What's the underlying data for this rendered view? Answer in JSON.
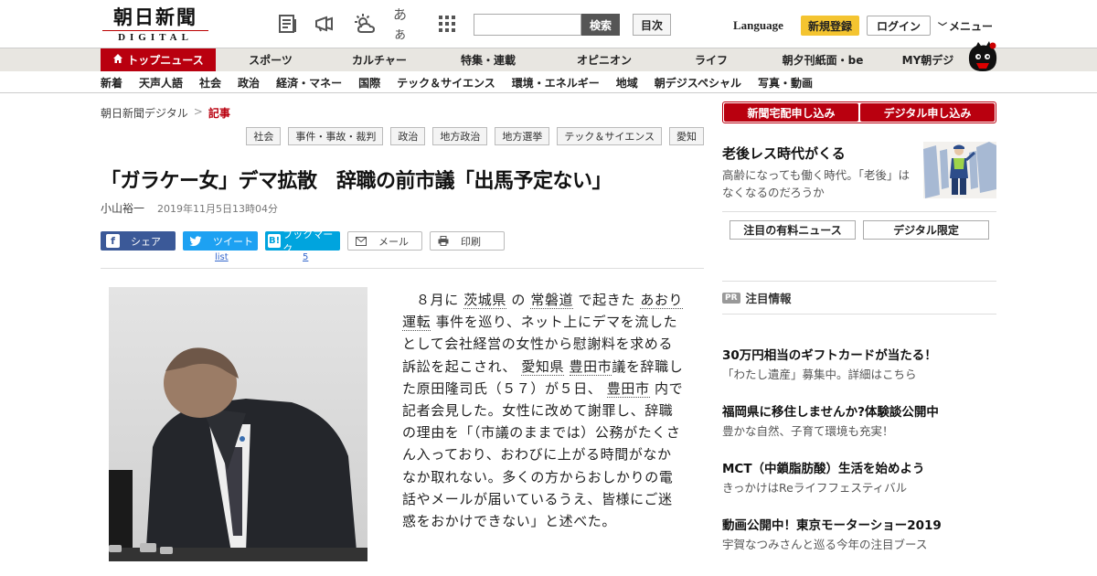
{
  "header": {
    "logo_main": "朝日新聞",
    "logo_sub": "DIGITAL",
    "icons": [
      "newspaper-icon",
      "megaphone-icon",
      "weather-icon",
      "font-size-icon",
      "grid-menu-icon"
    ],
    "font_size_glyph": "あぁ",
    "search_placeholder": "",
    "search_button": "検索",
    "toc_button": "目次",
    "language": "Language",
    "register": "新規登録",
    "login": "ログイン",
    "menu": "メニュー"
  },
  "main_nav": [
    {
      "label": "トップニュース",
      "active": true
    },
    {
      "label": "スポーツ"
    },
    {
      "label": "カルチャー"
    },
    {
      "label": "特集・連載"
    },
    {
      "label": "オピニオン"
    },
    {
      "label": "ライフ"
    },
    {
      "label": "朝夕刊紙面・be"
    },
    {
      "label": "MY朝デジ"
    }
  ],
  "sub_nav": [
    "新着",
    "天声人語",
    "社会",
    "政治",
    "経済・マネー",
    "国際",
    "テック＆サイエンス",
    "環境・エネルギー",
    "地域",
    "朝デジスペシャル",
    "写真・動画"
  ],
  "breadcrumb": {
    "root": "朝日新聞デジタル",
    "sep": ">",
    "current": "記事"
  },
  "tags": [
    "社会",
    "事件・事故・裁判",
    "政治",
    "地方政治",
    "地方選挙",
    "テック＆サイエンス",
    "愛知"
  ],
  "article": {
    "title": "「ガラケー女」デマ拡散　辞職の前市議「出馬予定ない」",
    "author": "小山裕一",
    "date": "2019年11月5日13時04分",
    "share": {
      "facebook": "シェア",
      "twitter": "ツイート",
      "hatena": "ブックマーク",
      "hatena_icon": "B!",
      "mail": "メール",
      "print": "印刷",
      "twitter_count": "list",
      "hatena_count": "5"
    },
    "body": {
      "p1": "８月に",
      "k1": "茨城県",
      "p2": "の",
      "k2": "常磐道",
      "p3": "で起きた",
      "k3": "あおり運転",
      "p4": "事件を巡り、ネット上にデマを流したとして会社経営の女性から慰謝料を求める訴訟を起こされ、",
      "k4": "愛知県",
      "k5": "豊田市",
      "p5": "議を辞職した原田隆司氏（５７）が５日、",
      "k6": "豊田市",
      "p6": "内で記者会見した。女性に改めて謝罪し、辞職の理由を「（市議のままでは）公務がたくさん入っており、おわびに上がる時間がなかなか取れない。多くの方からおしかりの電話やメールが届いているうえ、皆様にご迷惑をおかけできない」と述べた。"
    }
  },
  "sidebar": {
    "subscribe": [
      "新聞宅配申し込み",
      "デジタル申し込み"
    ],
    "promo": {
      "title": "老後レス時代がくる",
      "desc": "高齢になっても働く時代。「老後」はなくなるのだろうか"
    },
    "buttons": [
      "注目の有料ニュース",
      "デジタル限定"
    ],
    "pr": {
      "badge": "PR",
      "label": "注目情報"
    },
    "ads": [
      {
        "title": "30万円相当のギフトカードが当たる！",
        "sub": "「わたし遺産」募集中。詳細はこちら"
      },
      {
        "title": "福岡県に移住しませんか?体験談公開中",
        "sub": "豊かな自然、子育て環境も充実！"
      },
      {
        "title": "MCT（中鎖脂肪酸）生活を始めよう",
        "sub": "きっかけはReライフフェスティバル"
      },
      {
        "title": "動画公開中！東京モーターショー2019",
        "sub": "宇賀なつみさんと巡る今年の注目ブース"
      }
    ]
  },
  "colors": {
    "brand_red": "#b9000f",
    "register_yellow": "#f4c430",
    "facebook": "#3b5998",
    "twitter": "#1da1f2",
    "hatena": "#00a4de"
  }
}
